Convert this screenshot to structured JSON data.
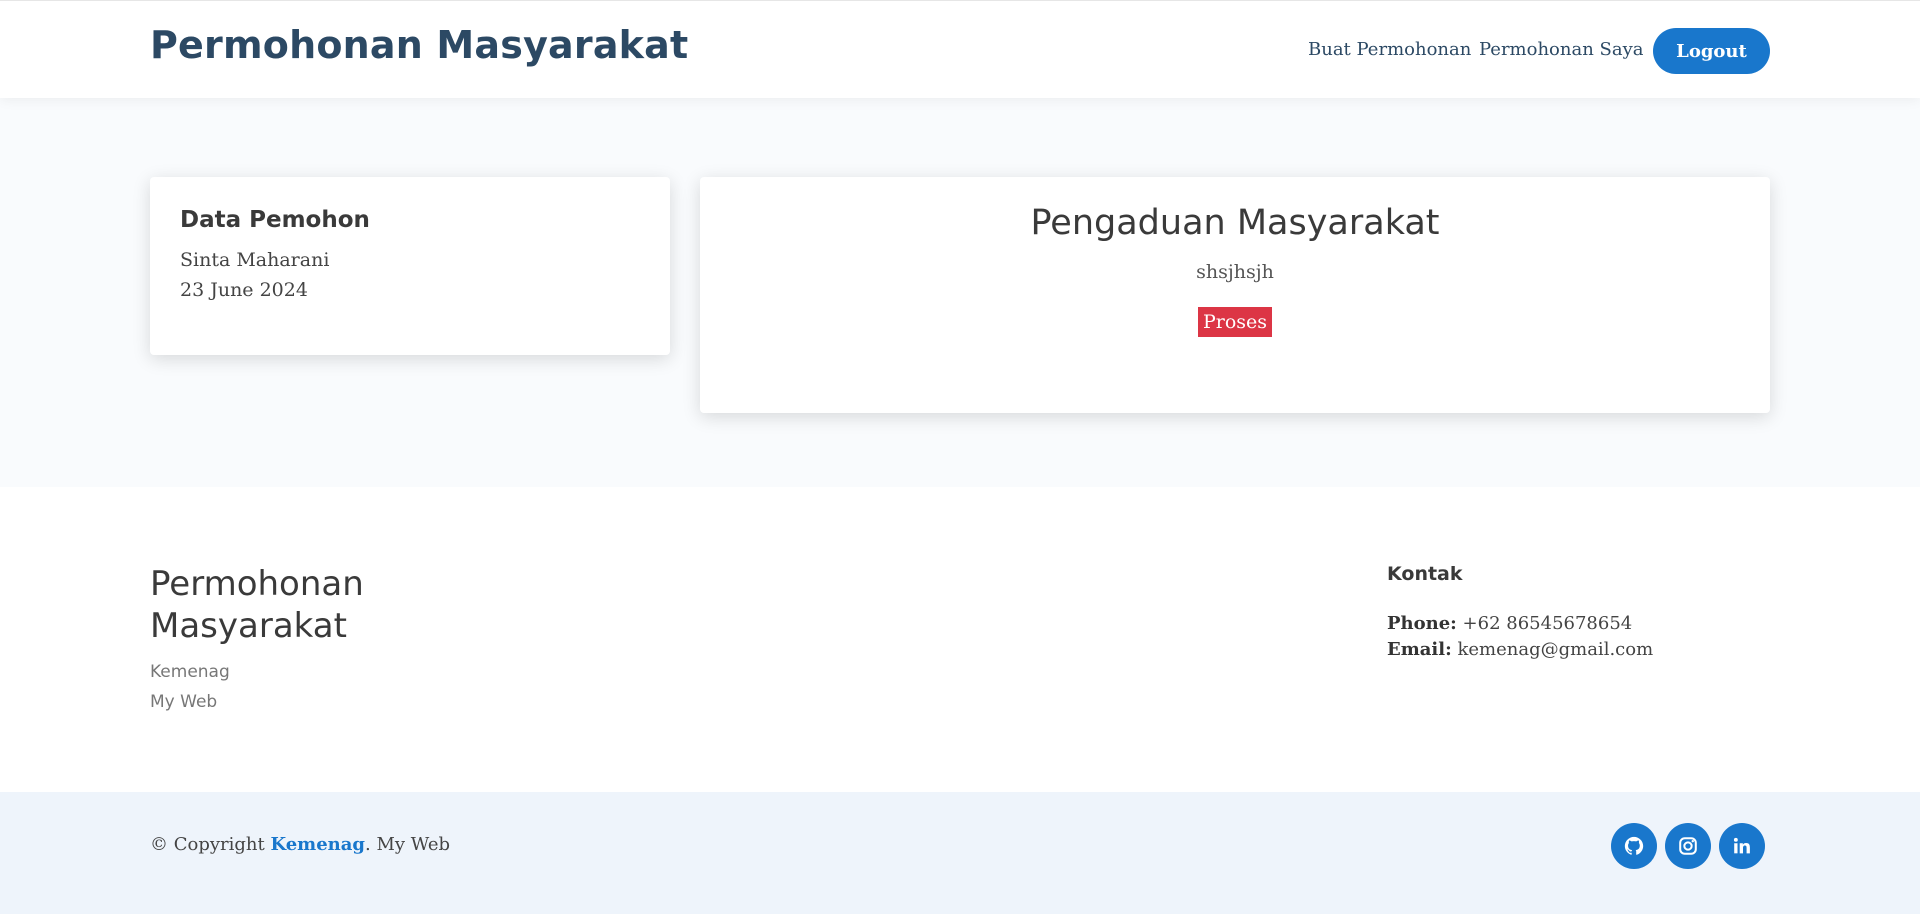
{
  "header": {
    "logo": "Permohonan Masyarakat",
    "nav": [
      "Buat Permohonan",
      "Permohonan Saya"
    ],
    "logout_label": "Logout",
    "accent_color": "#1977cc"
  },
  "applicant_card": {
    "title": "Data Pemohon",
    "name": "Sinta Maharani",
    "date": "23 June 2024"
  },
  "complaint_card": {
    "title": "Pengaduan Masyarakat",
    "description": "shsjhsjh",
    "status": "Proses",
    "status_color": "#dc3545"
  },
  "footer": {
    "title": "Permohonan Masyarakat",
    "subtitle_1": "Kemenag",
    "subtitle_2": "My Web",
    "contact_title": "Kontak",
    "phone_label": "Phone:",
    "phone": "+62 86545678654",
    "email_label": "Email:",
    "email": "kemenag@gmail.com",
    "copyright_prefix": "© Copyright",
    "copyright_brand": "Kemenag",
    "copyright_suffix": ". My Web",
    "social_icons": [
      "github-icon",
      "instagram-icon",
      "linkedin-icon"
    ]
  }
}
